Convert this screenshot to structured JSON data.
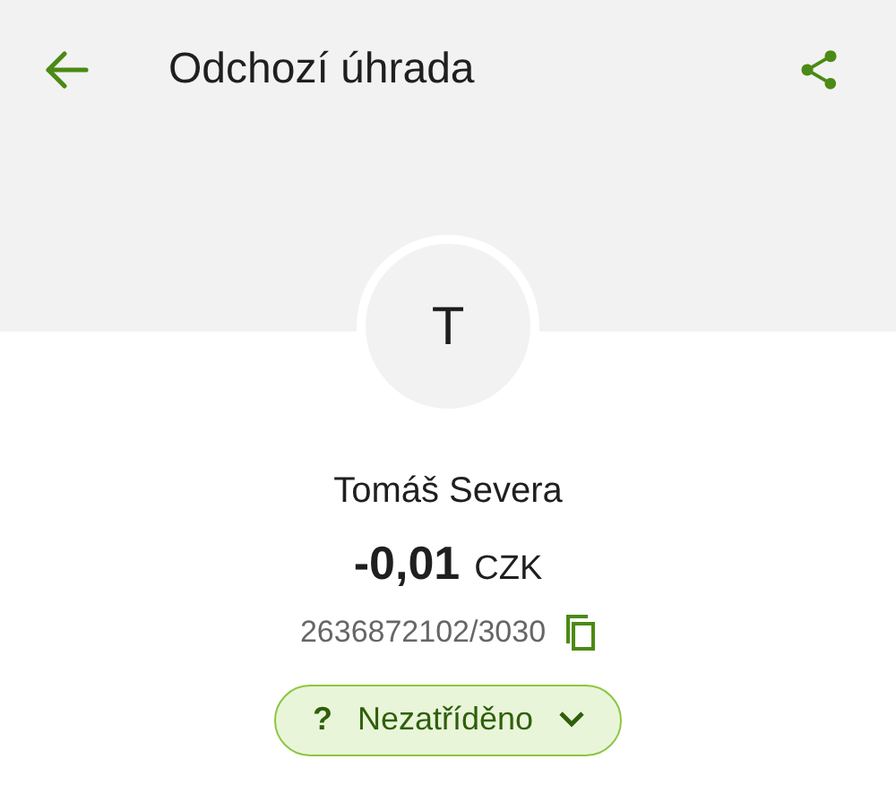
{
  "header": {
    "title": "Odchozí úhrada"
  },
  "avatar": {
    "initial": "T"
  },
  "counterparty": {
    "name": "Tomáš Severa",
    "amount": "-0,01",
    "currency": "CZK",
    "account": "2636872102/3030"
  },
  "category": {
    "icon": "?",
    "label": "Nezatříděno"
  }
}
